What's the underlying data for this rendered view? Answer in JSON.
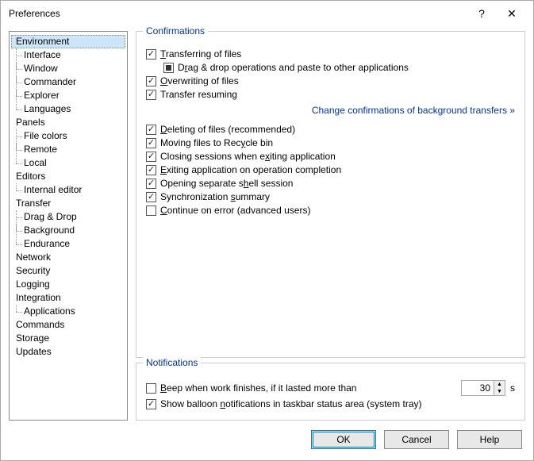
{
  "title": "Preferences",
  "tree": {
    "environment": "Environment",
    "interface": "Interface",
    "window": "Window",
    "commander": "Commander",
    "explorer": "Explorer",
    "languages": "Languages",
    "panels": "Panels",
    "file_colors": "File colors",
    "remote": "Remote",
    "local": "Local",
    "editors": "Editors",
    "internal_editor": "Internal editor",
    "transfer": "Transfer",
    "drag_drop": "Drag & Drop",
    "background": "Background",
    "endurance": "Endurance",
    "network": "Network",
    "security": "Security",
    "logging": "Logging",
    "integration": "Integration",
    "applications": "Applications",
    "commands": "Commands",
    "storage": "Storage",
    "updates": "Updates"
  },
  "confirmations": {
    "legend": "Confirmations",
    "transferring": {
      "pre": "",
      "u": "T",
      "post": "ransferring of files",
      "checked": true
    },
    "dragdrop": {
      "pre": "D",
      "u": "r",
      "post": "ag & drop operations and paste to other applications",
      "state": "square"
    },
    "overwriting": {
      "pre": "",
      "u": "O",
      "post": "verwriting of files",
      "checked": true
    },
    "resuming": {
      "pre": "Transfer resumin",
      "u": "g",
      "post": "",
      "checked": true
    },
    "bg_link": "Change confirmations of background transfers »",
    "deleting": {
      "pre": "",
      "u": "D",
      "post": "eleting of files (recommended)",
      "checked": true
    },
    "recycle": {
      "pre": "Moving files to Rec",
      "u": "y",
      "post": "cle bin",
      "checked": true
    },
    "closing": {
      "pre": "Closing sessions when e",
      "u": "x",
      "post": "iting application",
      "checked": true
    },
    "exiting": {
      "pre": "",
      "u": "E",
      "post": "xiting application on operation completion",
      "checked": true
    },
    "shell": {
      "pre": "Opening separate s",
      "u": "h",
      "post": "ell session",
      "checked": true
    },
    "sync": {
      "pre": "Synchronization ",
      "u": "s",
      "post": "ummary",
      "checked": true
    },
    "continue": {
      "pre": "",
      "u": "C",
      "post": "ontinue on error (advanced users)",
      "checked": false
    }
  },
  "notifications": {
    "legend": "Notifications",
    "beep": {
      "pre": "",
      "u": "B",
      "post": "eep when work finishes, if it lasted more than",
      "checked": false,
      "value": "30",
      "unit": "s"
    },
    "balloon": {
      "pre": "Show balloon ",
      "u": "n",
      "post": "otifications in taskbar status area (system tray)",
      "checked": true
    }
  },
  "buttons": {
    "ok": "OK",
    "cancel": "Cancel",
    "help": "Help"
  }
}
